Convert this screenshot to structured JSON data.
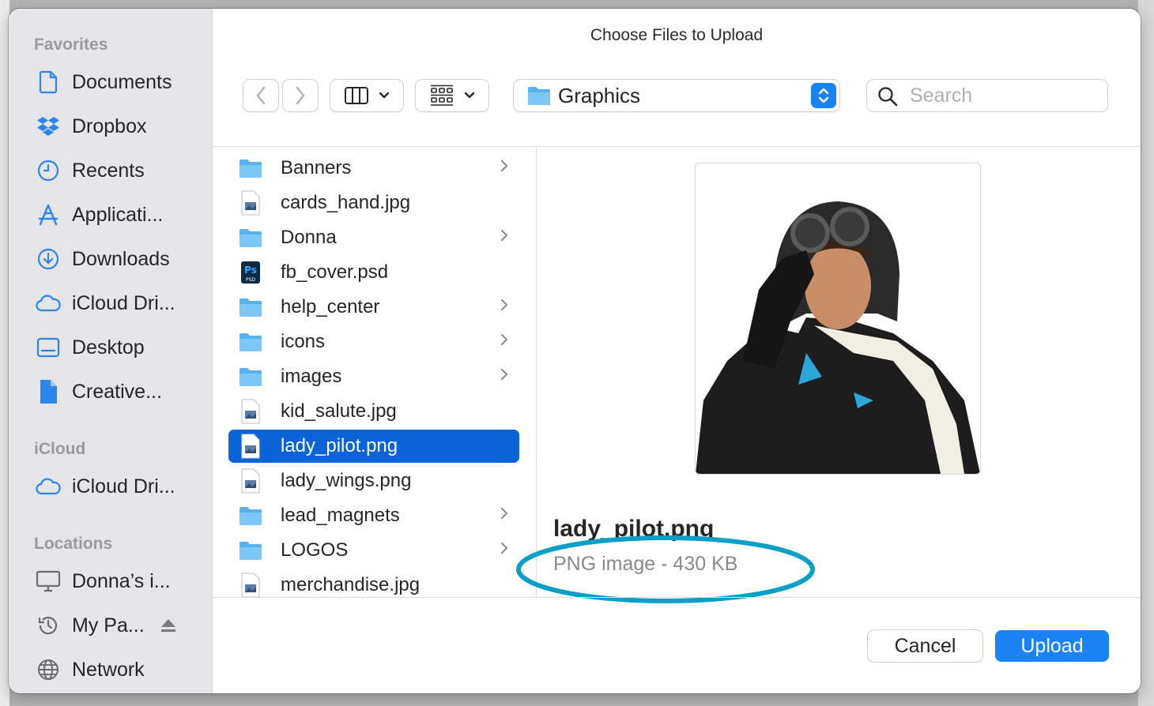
{
  "dialog": {
    "title": "Choose Files to Upload"
  },
  "sidebar": {
    "sections": [
      {
        "label": "Favorites",
        "items": [
          {
            "label": "Documents",
            "icon": "document-icon"
          },
          {
            "label": "Dropbox",
            "icon": "dropbox-icon"
          },
          {
            "label": "Recents",
            "icon": "clock-icon"
          },
          {
            "label": "Applicati...",
            "icon": "applications-icon"
          },
          {
            "label": "Downloads",
            "icon": "download-icon"
          },
          {
            "label": "iCloud Dri...",
            "icon": "cloud-icon"
          },
          {
            "label": "Desktop",
            "icon": "desktop-icon"
          },
          {
            "label": "Creative...",
            "icon": "file-icon"
          }
        ]
      },
      {
        "label": "iCloud",
        "items": [
          {
            "label": "iCloud Dri...",
            "icon": "cloud-icon"
          }
        ]
      },
      {
        "label": "Locations",
        "items": [
          {
            "label": "Donna’s i...",
            "icon": "computer-icon"
          },
          {
            "label": "My Pa...",
            "icon": "time-machine-icon"
          },
          {
            "label": "Network",
            "icon": "globe-icon"
          }
        ]
      }
    ]
  },
  "toolbar": {
    "current_folder": "Graphics",
    "search_placeholder": "Search"
  },
  "files": [
    {
      "name": "Banners",
      "kind": "folder"
    },
    {
      "name": "cards_hand.jpg",
      "kind": "image"
    },
    {
      "name": "Donna",
      "kind": "folder"
    },
    {
      "name": "fb_cover.psd",
      "kind": "psd"
    },
    {
      "name": "help_center",
      "kind": "folder"
    },
    {
      "name": "icons",
      "kind": "folder"
    },
    {
      "name": "images",
      "kind": "folder"
    },
    {
      "name": "kid_salute.jpg",
      "kind": "image"
    },
    {
      "name": "lady_pilot.png",
      "kind": "image",
      "selected": true
    },
    {
      "name": "lady_wings.png",
      "kind": "image"
    },
    {
      "name": "lead_magnets",
      "kind": "folder"
    },
    {
      "name": "LOGOS",
      "kind": "folder"
    },
    {
      "name": "merchandise.jpg",
      "kind": "image"
    }
  ],
  "preview": {
    "name": "lady_pilot.png",
    "info": "PNG image - 430 KB"
  },
  "buttons": {
    "cancel": "Cancel",
    "upload": "Upload"
  },
  "colors": {
    "accent": "#1b83f6",
    "selection": "#0a64d8",
    "annotation": "#0a9fc7",
    "sidebar_icon": "#2b86f0"
  }
}
